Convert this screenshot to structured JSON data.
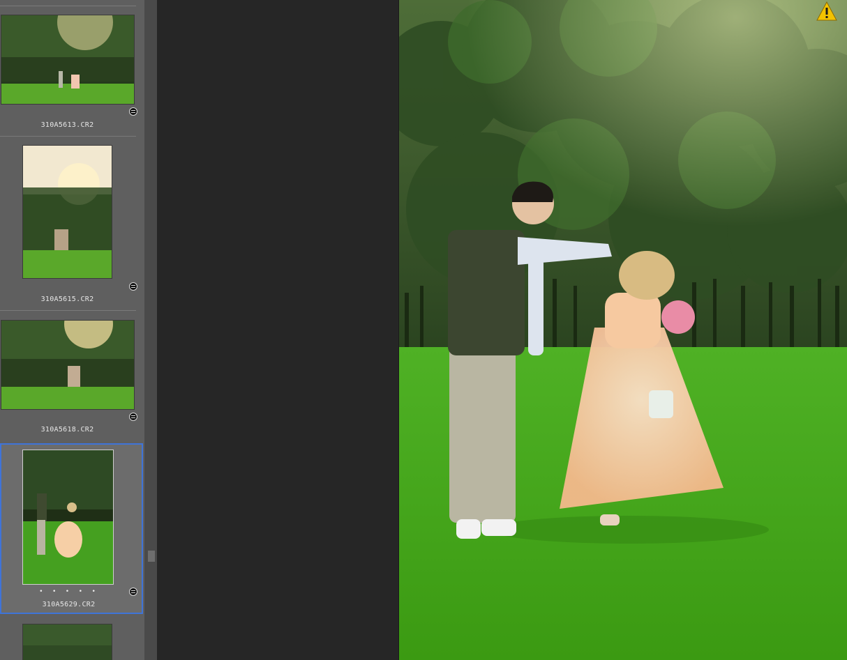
{
  "filmstrip": {
    "items": [
      {
        "filename": "310A5613.CR2",
        "selected": false,
        "orientation": "landscape"
      },
      {
        "filename": "310A5615.CR2",
        "selected": false,
        "orientation": "portrait"
      },
      {
        "filename": "310A5618.CR2",
        "selected": false,
        "orientation": "landscape"
      },
      {
        "filename": "310A5629.CR2",
        "selected": true,
        "orientation": "portrait",
        "rating_dots": "• • • • •"
      },
      {
        "filename": "",
        "selected": false,
        "orientation": "portrait"
      }
    ]
  },
  "preview": {
    "warning_icon": "warning-triangle-icon",
    "warning_color": "#f2c200"
  },
  "colors": {
    "selection": "#3f74d8",
    "panel": "#5f5f5f",
    "background": "#262626"
  }
}
